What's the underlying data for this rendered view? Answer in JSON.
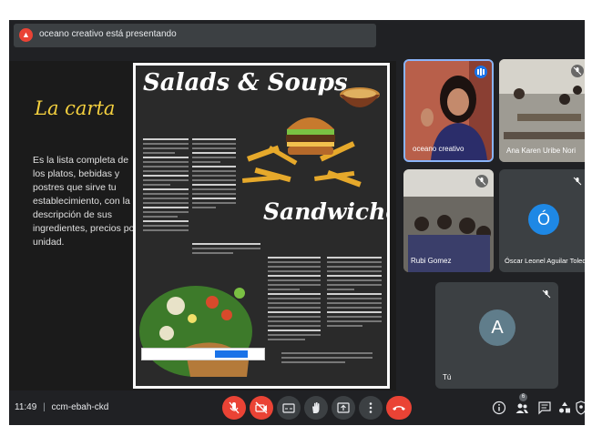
{
  "presenter_bar": {
    "text": "oceano creativo está presentando",
    "icon": "present-screen-icon"
  },
  "slide": {
    "title": "La carta",
    "body": "Es la lista completa de los platos, bebidas y postres que sirve tu establecimiento, con la descripción de sus ingredientes, precios por unidad.",
    "menu": {
      "heading_top": "Salads & Soups",
      "heading_bottom": "Sandwiches"
    }
  },
  "participants": [
    {
      "name": "oceano creativo",
      "speaking": true
    },
    {
      "name": "Ana Karen Uribe Nori",
      "muted": true
    },
    {
      "name": "Rubi Gomez",
      "muted": true
    },
    {
      "name": "Óscar Leonel Aguilar Toledo",
      "initial": "Ó",
      "avatar_color": "#1e88e5",
      "muted": true
    },
    {
      "name": "Tú",
      "initial": "A",
      "avatar_color": "#607d8b",
      "muted": true
    }
  ],
  "bottom_bar": {
    "time": "11:49",
    "separator": "|",
    "meeting_code": "ccm-ebah-ckd",
    "participant_count": "6",
    "controls": [
      "mic-off-icon",
      "camera-off-icon",
      "captions-icon",
      "raise-hand-icon",
      "present-icon",
      "more-options-icon",
      "end-call-icon"
    ],
    "right_icons": [
      "info-icon",
      "people-icon",
      "chat-icon",
      "activities-icon",
      "host-controls-icon"
    ]
  },
  "colors": {
    "background": "#202124",
    "tile": "#3c4043",
    "accent_red": "#ea4335",
    "accent_blue": "#1a73e8",
    "slide_title": "#f4d03f"
  }
}
